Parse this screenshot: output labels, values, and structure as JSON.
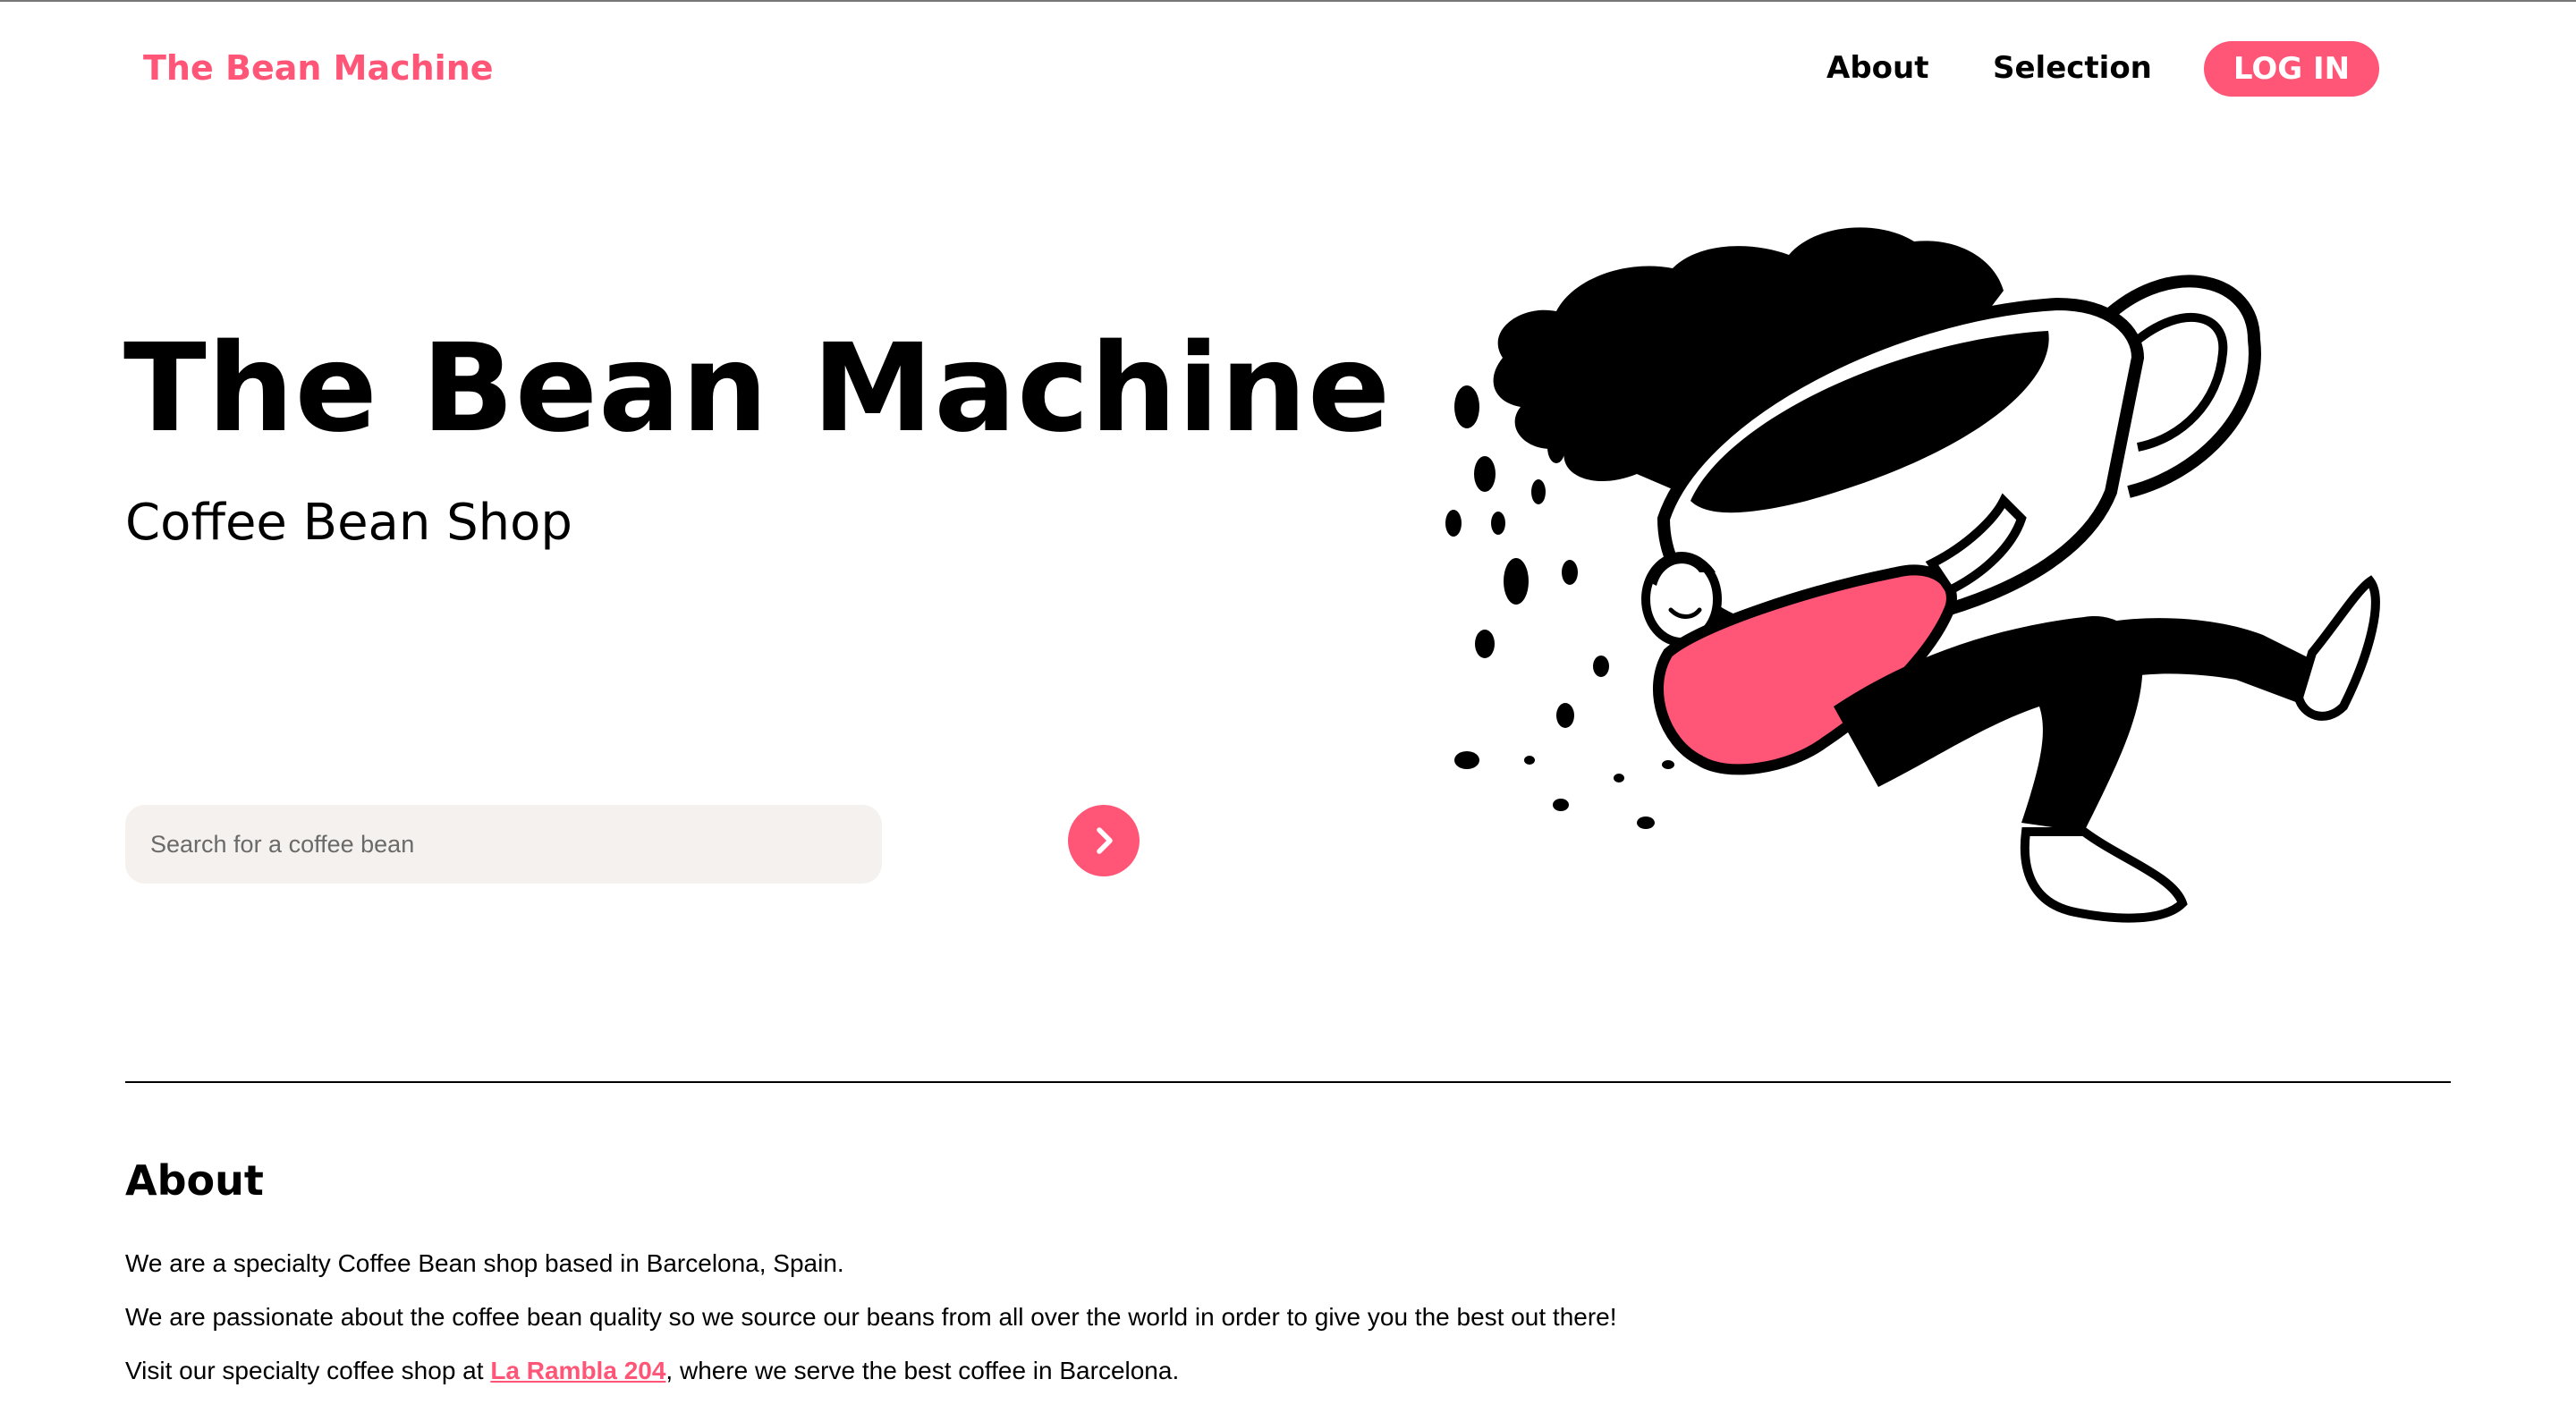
{
  "header": {
    "brand": "The Bean Machine",
    "nav": {
      "about": "About",
      "selection": "Selection",
      "login": "LOG IN"
    }
  },
  "hero": {
    "title": "The Bean Machine",
    "subtitle": "Coffee Bean Shop",
    "search": {
      "placeholder": "Search for a coffee bean",
      "value": "",
      "submit_icon": "chevron-right-icon"
    },
    "illustration": "person-hugging-coffee-cup-illustration"
  },
  "about": {
    "heading": "About",
    "paragraph1": "We are a specialty Coffee Bean shop based in Barcelona, Spain.",
    "paragraph2": "We are passionate about the coffee bean quality so we source our beans from all over the world in order to give you the best out there!",
    "paragraph3": {
      "before": "Visit our specialty coffee shop at ",
      "link": "La Rambla 204",
      "after": ", where we serve the best coffee in Barcelona."
    }
  },
  "colors": {
    "accent": "#ff5577",
    "search_bg": "#f5f1ee",
    "text": "#000000"
  }
}
